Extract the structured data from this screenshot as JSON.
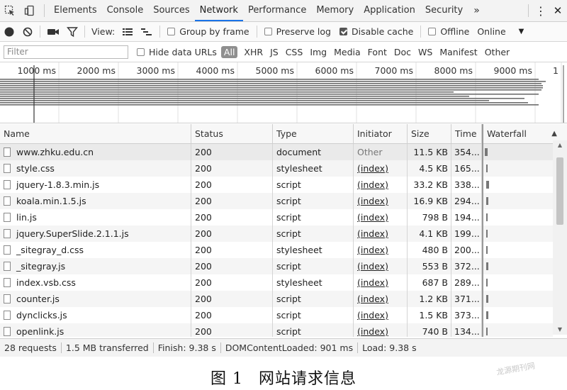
{
  "tabs": [
    {
      "label": "Elements"
    },
    {
      "label": "Console"
    },
    {
      "label": "Sources"
    },
    {
      "label": "Network",
      "active": true
    },
    {
      "label": "Performance"
    },
    {
      "label": "Memory"
    },
    {
      "label": "Application"
    },
    {
      "label": "Security"
    }
  ],
  "tabs_more": "»",
  "toolbar": {
    "view_label": "View:",
    "group_by_frame": {
      "label": "Group by frame",
      "checked": false
    },
    "preserve_log": {
      "label": "Preserve log",
      "checked": false
    },
    "disable_cache": {
      "label": "Disable cache",
      "checked": true
    },
    "offline": {
      "label": "Offline",
      "checked": false
    },
    "throttling": "Online"
  },
  "filter": {
    "placeholder": "Filter",
    "hide_data_urls": {
      "label": "Hide data URLs",
      "checked": false
    },
    "types": [
      "All",
      "XHR",
      "JS",
      "CSS",
      "Img",
      "Media",
      "Font",
      "Doc",
      "WS",
      "Manifest",
      "Other"
    ]
  },
  "overview": {
    "ticks": [
      "1000 ms",
      "2000 ms",
      "3000 ms",
      "4000 ms",
      "5000 ms",
      "6000 ms",
      "7000 ms",
      "8000 ms",
      "9000 ms",
      "1"
    ]
  },
  "columns": [
    "Name",
    "Status",
    "Type",
    "Initiator",
    "Size",
    "Time",
    "Waterfall"
  ],
  "requests": [
    {
      "name": "www.zhku.edu.cn",
      "status": "200",
      "type": "document",
      "initiator": "Other",
      "size": "11.5 KB",
      "time": "354..."
    },
    {
      "name": "style.css",
      "status": "200",
      "type": "stylesheet",
      "initiator": "(index)",
      "size": "4.5 KB",
      "time": "165..."
    },
    {
      "name": "jquery-1.8.3.min.js",
      "status": "200",
      "type": "script",
      "initiator": "(index)",
      "size": "33.2 KB",
      "time": "338..."
    },
    {
      "name": "koala.min.1.5.js",
      "status": "200",
      "type": "script",
      "initiator": "(index)",
      "size": "16.9 KB",
      "time": "294..."
    },
    {
      "name": "lin.js",
      "status": "200",
      "type": "script",
      "initiator": "(index)",
      "size": "798 B",
      "time": "194..."
    },
    {
      "name": "jquery.SuperSlide.2.1.1.js",
      "status": "200",
      "type": "script",
      "initiator": "(index)",
      "size": "4.1 KB",
      "time": "199..."
    },
    {
      "name": "_sitegray_d.css",
      "status": "200",
      "type": "stylesheet",
      "initiator": "(index)",
      "size": "480 B",
      "time": "200..."
    },
    {
      "name": "_sitegray.js",
      "status": "200",
      "type": "script",
      "initiator": "(index)",
      "size": "553 B",
      "time": "372..."
    },
    {
      "name": "index.vsb.css",
      "status": "200",
      "type": "stylesheet",
      "initiator": "(index)",
      "size": "687 B",
      "time": "289..."
    },
    {
      "name": "counter.js",
      "status": "200",
      "type": "script",
      "initiator": "(index)",
      "size": "1.2 KB",
      "time": "371..."
    },
    {
      "name": "dynclicks.js",
      "status": "200",
      "type": "script",
      "initiator": "(index)",
      "size": "1.5 KB",
      "time": "373..."
    },
    {
      "name": "openlink.js",
      "status": "200",
      "type": "script",
      "initiator": "(index)",
      "size": "740 B",
      "time": "134..."
    }
  ],
  "status": {
    "requests": "28 requests",
    "transferred": "1.5 MB transferred",
    "finish": "Finish: 9.38 s",
    "dom_content_loaded": "DOMContentLoaded: 901 ms",
    "load": "Load: 9.38 s"
  },
  "caption": {
    "figure": "图 1",
    "title": "网站请求信息"
  },
  "watermark": "龙源期刊网",
  "colors": {
    "active_tab_underline": "#1a73e8",
    "record_button": "#333333"
  }
}
